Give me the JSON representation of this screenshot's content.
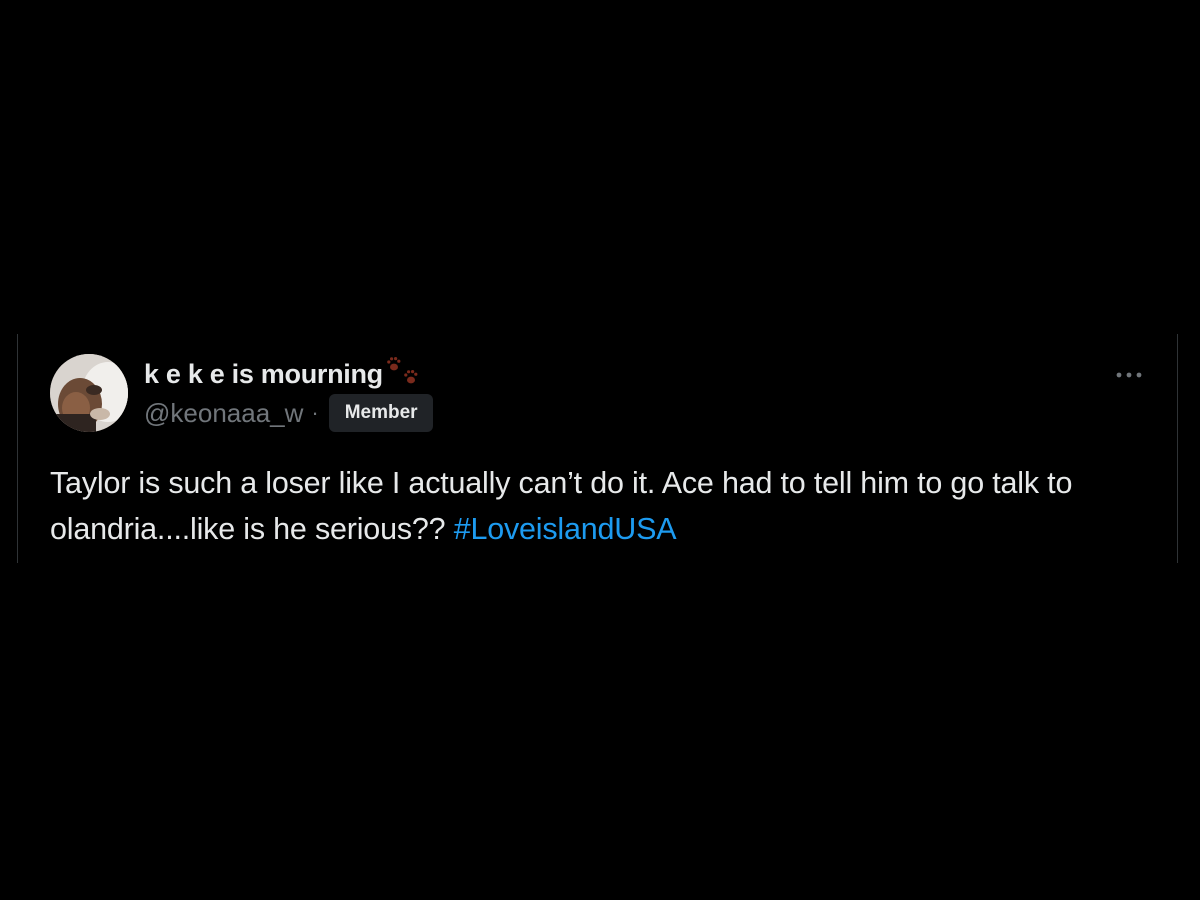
{
  "tweet": {
    "display_name": "k e k e is mourning",
    "display_name_emoji": "paw-prints-icon",
    "handle": "@keonaaa_w",
    "separator": "·",
    "badge": "Member",
    "more_icon": "more-horizontal-icon",
    "text": "Taylor is such a loser like I actually can’t do it. Ace had to tell him to go talk to olandria....like is he serious?? ",
    "hashtag": "#LoveislandUSA"
  },
  "colors": {
    "background": "#000000",
    "text": "#e7e9ea",
    "secondary_text": "#71767b",
    "link": "#1d9bf0",
    "badge_bg": "#202327",
    "border": "#2f3336",
    "paw": "#7a2a1c"
  }
}
